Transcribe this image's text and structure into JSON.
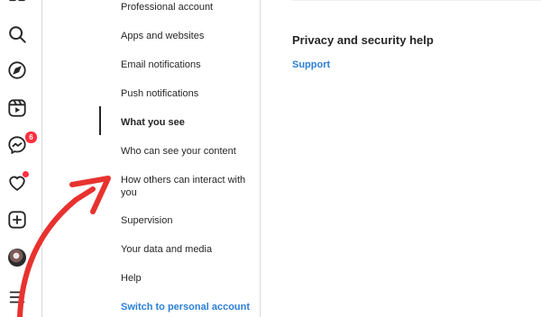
{
  "nav_rail": {
    "icons": [
      "grid-icon",
      "search-icon",
      "explore-icon",
      "reels-icon",
      "messenger-icon",
      "heart-icon",
      "create-icon",
      "avatar",
      "menu-icon"
    ],
    "messages_badge": "6"
  },
  "settings_menu": {
    "items": [
      {
        "label": "Professional account"
      },
      {
        "label": "Apps and websites"
      },
      {
        "label": "Email notifications"
      },
      {
        "label": "Push notifications"
      },
      {
        "label": "What you see"
      },
      {
        "label": "Who can see your content"
      },
      {
        "label": "How others can interact with you"
      },
      {
        "label": "Supervision"
      },
      {
        "label": "Your data and media"
      },
      {
        "label": "Help"
      },
      {
        "label": "Switch to personal account"
      }
    ],
    "active_item": "What you see"
  },
  "main": {
    "help_title": "Privacy and security help",
    "support_link": "Support"
  },
  "colors": {
    "accent": "#2c7fd6",
    "annotation_arrow": "#e8322f",
    "badge": "#ff3040",
    "divider": "#dbdbdb"
  }
}
